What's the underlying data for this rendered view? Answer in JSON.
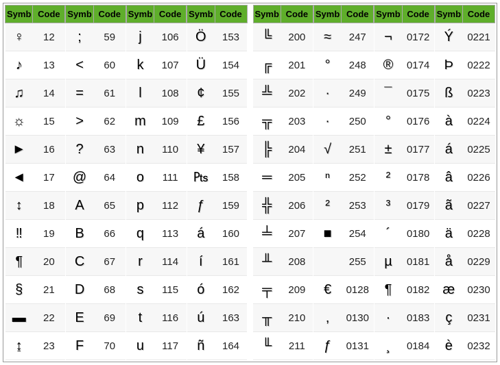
{
  "headers": {
    "symb": "Symb",
    "code": "Code"
  },
  "left": [
    [
      {
        "symb": "♀",
        "code": "12"
      },
      {
        "symb": "♪",
        "code": "13"
      },
      {
        "symb": "♫",
        "code": "14"
      },
      {
        "symb": "☼",
        "code": "15"
      },
      {
        "symb": "►",
        "code": "16"
      },
      {
        "symb": "◄",
        "code": "17"
      },
      {
        "symb": "↕",
        "code": "18"
      },
      {
        "symb": "‼",
        "code": "19"
      },
      {
        "symb": "¶",
        "code": "20"
      },
      {
        "symb": "§",
        "code": "21"
      },
      {
        "symb": "▬",
        "code": "22"
      },
      {
        "symb": "↨",
        "code": "23"
      }
    ],
    [
      {
        "symb": ";",
        "code": "59"
      },
      {
        "symb": "<",
        "code": "60"
      },
      {
        "symb": "=",
        "code": "61"
      },
      {
        "symb": ">",
        "code": "62"
      },
      {
        "symb": "?",
        "code": "63"
      },
      {
        "symb": "@",
        "code": "64"
      },
      {
        "symb": "A",
        "code": "65"
      },
      {
        "symb": "B",
        "code": "66"
      },
      {
        "symb": "C",
        "code": "67"
      },
      {
        "symb": "D",
        "code": "68"
      },
      {
        "symb": "E",
        "code": "69"
      },
      {
        "symb": "F",
        "code": "70"
      }
    ],
    [
      {
        "symb": "j",
        "code": "106"
      },
      {
        "symb": "k",
        "code": "107"
      },
      {
        "symb": "l",
        "code": "108"
      },
      {
        "symb": "m",
        "code": "109"
      },
      {
        "symb": "n",
        "code": "110"
      },
      {
        "symb": "o",
        "code": "111"
      },
      {
        "symb": "p",
        "code": "112"
      },
      {
        "symb": "q",
        "code": "113"
      },
      {
        "symb": "r",
        "code": "114"
      },
      {
        "symb": "s",
        "code": "115"
      },
      {
        "symb": "t",
        "code": "116"
      },
      {
        "symb": "u",
        "code": "117"
      }
    ],
    [
      {
        "symb": "Ö",
        "code": "153"
      },
      {
        "symb": "Ü",
        "code": "154"
      },
      {
        "symb": "¢",
        "code": "155"
      },
      {
        "symb": "£",
        "code": "156"
      },
      {
        "symb": "¥",
        "code": "157"
      },
      {
        "symb": "₧",
        "code": "158"
      },
      {
        "symb": "ƒ",
        "code": "159"
      },
      {
        "symb": "á",
        "code": "160"
      },
      {
        "symb": "í",
        "code": "161"
      },
      {
        "symb": "ó",
        "code": "162"
      },
      {
        "symb": "ú",
        "code": "163"
      },
      {
        "symb": "ñ",
        "code": "164"
      }
    ]
  ],
  "right": [
    [
      {
        "symb": "╚",
        "code": "200"
      },
      {
        "symb": "╔",
        "code": "201"
      },
      {
        "symb": "╩",
        "code": "202"
      },
      {
        "symb": "╦",
        "code": "203"
      },
      {
        "symb": "╠",
        "code": "204"
      },
      {
        "symb": "═",
        "code": "205"
      },
      {
        "symb": "╬",
        "code": "206"
      },
      {
        "symb": "╧",
        "code": "207"
      },
      {
        "symb": "╨",
        "code": "208"
      },
      {
        "symb": "╤",
        "code": "209"
      },
      {
        "symb": "╥",
        "code": "210"
      },
      {
        "symb": "╙",
        "code": "211"
      }
    ],
    [
      {
        "symb": "≈",
        "code": "247"
      },
      {
        "symb": "°",
        "code": "248"
      },
      {
        "symb": "∙",
        "code": "249"
      },
      {
        "symb": "·",
        "code": "250"
      },
      {
        "symb": "√",
        "code": "251"
      },
      {
        "symb": "ⁿ",
        "code": "252"
      },
      {
        "symb": "²",
        "code": "253"
      },
      {
        "symb": "■",
        "code": "254"
      },
      {
        "symb": " ",
        "code": "255"
      },
      {
        "symb": "€",
        "code": "0128"
      },
      {
        "symb": "‚",
        "code": "0130"
      },
      {
        "symb": "ƒ",
        "code": "0131"
      }
    ],
    [
      {
        "symb": "¬",
        "code": "0172"
      },
      {
        "symb": "®",
        "code": "0174"
      },
      {
        "symb": "¯",
        "code": "0175"
      },
      {
        "symb": "°",
        "code": "0176"
      },
      {
        "symb": "±",
        "code": "0177"
      },
      {
        "symb": "²",
        "code": "0178"
      },
      {
        "symb": "³",
        "code": "0179"
      },
      {
        "symb": "´",
        "code": "0180"
      },
      {
        "symb": "µ",
        "code": "0181"
      },
      {
        "symb": "¶",
        "code": "0182"
      },
      {
        "symb": "·",
        "code": "0183"
      },
      {
        "symb": "¸",
        "code": "0184"
      }
    ],
    [
      {
        "symb": "Ý",
        "code": "0221"
      },
      {
        "symb": "Þ",
        "code": "0222"
      },
      {
        "symb": "ß",
        "code": "0223"
      },
      {
        "symb": "à",
        "code": "0224"
      },
      {
        "symb": "á",
        "code": "0225"
      },
      {
        "symb": "â",
        "code": "0226"
      },
      {
        "symb": "ã",
        "code": "0227"
      },
      {
        "symb": "ä",
        "code": "0228"
      },
      {
        "symb": "å",
        "code": "0229"
      },
      {
        "symb": "æ",
        "code": "0230"
      },
      {
        "symb": "ç",
        "code": "0231"
      },
      {
        "symb": "è",
        "code": "0232"
      }
    ]
  ]
}
